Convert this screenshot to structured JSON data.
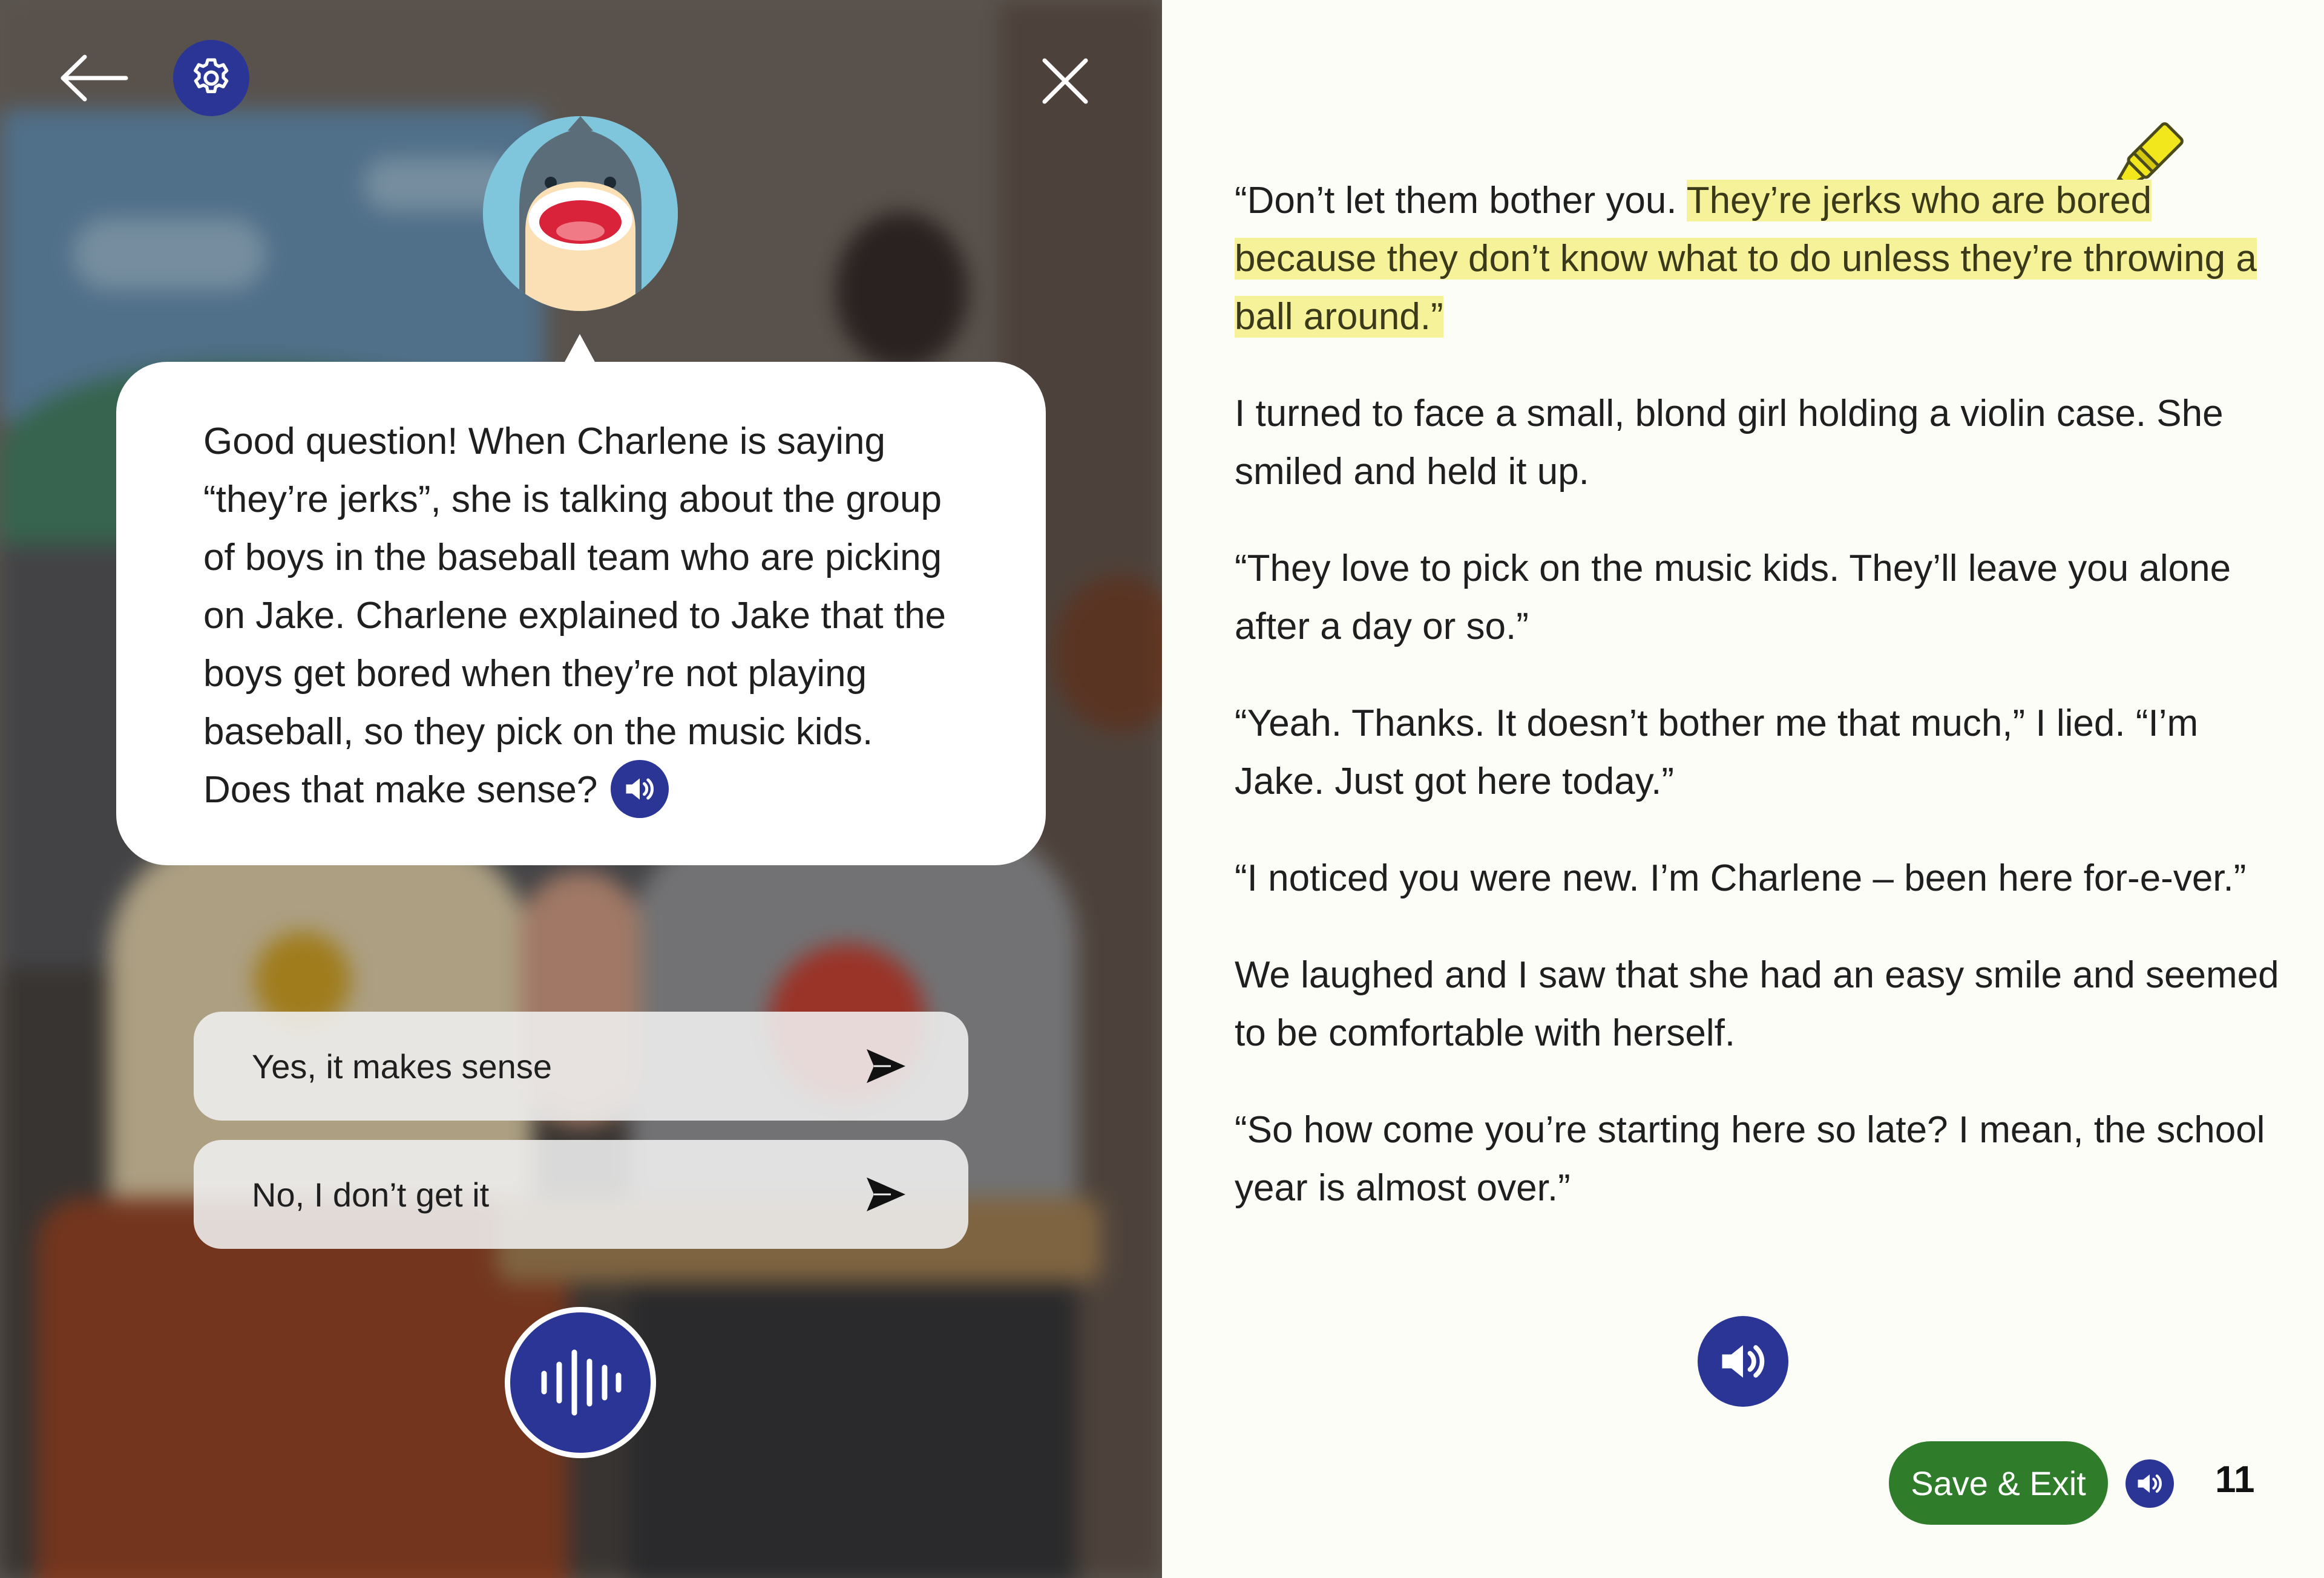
{
  "colors": {
    "accent_blue": "#2a3596",
    "save_green": "#2f7d2a",
    "highlight_yellow": "#f5f29a",
    "page_background": "#fdfdf7"
  },
  "left_panel": {
    "icons": {
      "back": "arrow-left-icon",
      "settings": "gear-icon",
      "close": "close-icon",
      "avatar": "shark-avatar-icon"
    },
    "assistant_message": "Good question! When Charlene is saying “they’re jerks”, she is talking about the group of boys in the baseball team who are picking on Jake. Charlene explained to Jake that the boys get bored when they’re not playing baseball, so they pick on the music kids. Does that make sense?",
    "replies": [
      {
        "label": "Yes, it makes sense",
        "icon": "send-icon"
      },
      {
        "label": "No, I don’t get it",
        "icon": "send-icon"
      }
    ],
    "mic_icon": "voice-waveform-icon"
  },
  "story": {
    "paragraph_1_plain": "“Don’t let them bother you. ",
    "paragraph_1_highlighted": "They’re jerks who are bored because they don’t know what to do unless they’re throwing a ball around.”",
    "paragraphs": [
      "I turned to face a small, blond girl holding a violin case. She smiled and held it up.",
      "“They love to pick on the music kids. They’ll leave you alone after a day or so.”",
      "“Yeah. Thanks. It doesn’t bother me that much,” I lied. “I’m Jake. Just got here today.”",
      "“I noticed you were new. I’m Charlene – been here for-e-ver.”",
      "We laughed and I saw that she had an easy smile and seemed to be comfortable with herself.",
      "“So how come you’re starting here so late? I mean, the school year is almost over.”"
    ],
    "highlighter_icon": "highlighter-icon"
  },
  "footer": {
    "save_exit_label": "Save & Exit",
    "page_number": "11"
  }
}
